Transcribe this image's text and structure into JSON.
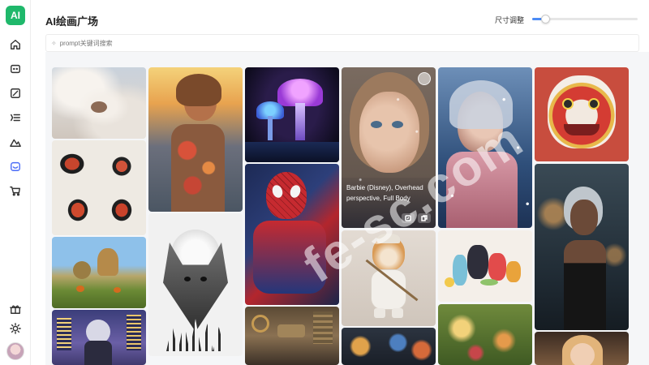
{
  "app": {
    "logo_text": "AI",
    "title": "AI绘画广场"
  },
  "toolbar": {
    "size_label": "尺寸调整",
    "slider_value": 0.12
  },
  "search": {
    "placeholder": "prompt关键词搜索"
  },
  "nav": {
    "items": [
      {
        "icon": "home-icon"
      },
      {
        "icon": "chat-icon"
      },
      {
        "icon": "image-edit-icon"
      },
      {
        "icon": "list-icon"
      },
      {
        "icon": "mountain-icon"
      },
      {
        "icon": "gallery-icon",
        "active": true
      },
      {
        "icon": "cart-icon"
      }
    ],
    "bottom": [
      {
        "icon": "gift-icon"
      },
      {
        "icon": "sun-icon"
      }
    ]
  },
  "hover_card": {
    "caption": "Barbie (Disney), Overhead perspective, Full Body"
  },
  "watermark": "fe-sc.com",
  "colors": {
    "brand": "#1fb86b",
    "accent": "#4b6cf7",
    "slider": "#4b8bf5"
  }
}
